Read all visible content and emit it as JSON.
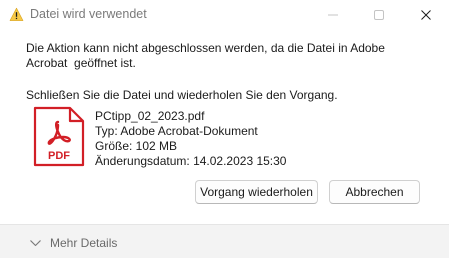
{
  "window": {
    "title": "Datei wird verwendet"
  },
  "message": {
    "line1": "Die Aktion kann nicht abgeschlossen werden, da die Datei in Adobe\nAcrobat  geöffnet ist.",
    "line2": "Schließen Sie die Datei und wiederholen Sie den Vorgang."
  },
  "file": {
    "icon": "pdf-file-icon",
    "icon_label": "PDF",
    "name": "PCtipp_02_2023.pdf",
    "type": "Typ: Adobe Acrobat-Dokument",
    "size": "Größe: 102 MB",
    "modified": "Änderungsdatum: 14.02.2023 15:30"
  },
  "buttons": {
    "retry": "Vorgang wiederholen",
    "cancel": "Abbrechen"
  },
  "details": {
    "label": "Mehr Details",
    "icon": "chevron-down-icon"
  },
  "colors": {
    "pdf_red": "#d21f26",
    "background": "#f3f3f3"
  }
}
